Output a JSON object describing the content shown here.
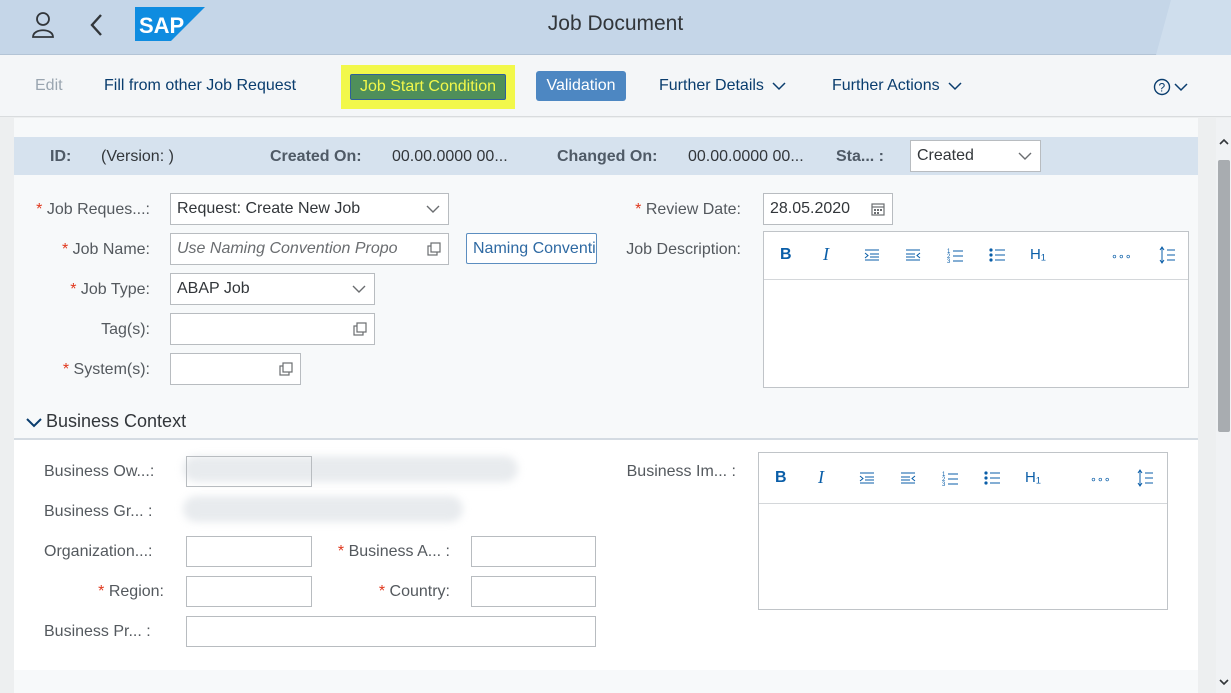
{
  "shell": {
    "title": "Job Document",
    "logo_text": "SAP"
  },
  "toolbar": {
    "edit": "Edit",
    "fill_from_other": "Fill from other Job Request",
    "job_start_condition": "Job Start Condition",
    "validation": "Validation",
    "further_details": "Further Details",
    "further_actions": "Further Actions"
  },
  "header": {
    "id_label": "ID:",
    "version": "(Version: )",
    "created_on_label": "Created On:",
    "created_on_value": "00.00.0000 00...",
    "changed_on_label": "Changed On:",
    "changed_on_value": "00.00.0000 00...",
    "status_label": "Sta... :",
    "status_value": "Created"
  },
  "form": {
    "job_request_label": "Job Reques...:",
    "job_request_value": "Request: Create New Job",
    "job_name_label": "Job Name:",
    "job_name_placeholder": "Use Naming Convention Propo",
    "naming_convention_button": "Naming Conventions",
    "job_type_label": "Job Type:",
    "job_type_value": "ABAP Job",
    "tags_label": "Tag(s):",
    "systems_label": "System(s):",
    "review_date_label": "Review Date:",
    "review_date_value": "28.05.2020",
    "job_description_label": "Job Description:"
  },
  "rte_buttons": {
    "bold": "B",
    "italic": "I",
    "heading": "H₁",
    "more": "∘∘∘"
  },
  "business_context": {
    "title": "Business Context",
    "business_owner_label": "Business Ow...:",
    "business_group_label": "Business Gr... :",
    "organization_label": "Organization...:",
    "business_area_label": "Business A... :",
    "region_label": "Region:",
    "country_label": "Country:",
    "business_process_label": "Business Pr... :",
    "business_impact_label": "Business Im... :"
  },
  "required_marker": "*",
  "colors": {
    "shell": "#c5d6e8",
    "highlight": "#f2f84a",
    "emphasized_button": "#4d87c2",
    "required": "#e0371c"
  }
}
